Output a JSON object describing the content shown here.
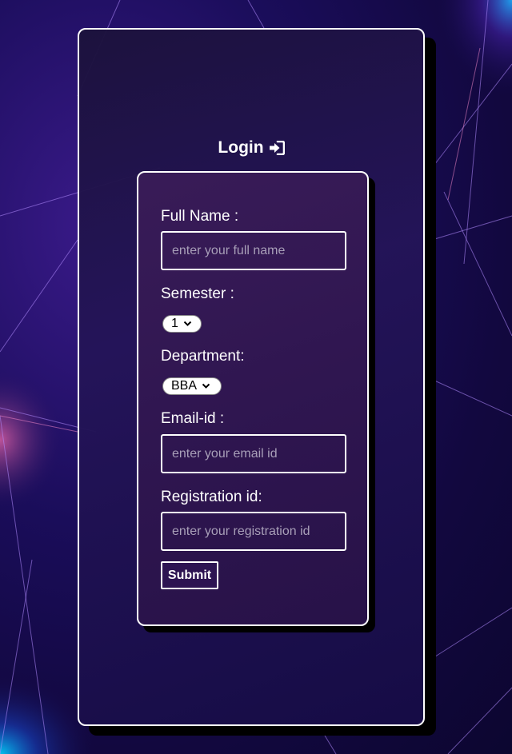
{
  "form": {
    "title": "Login",
    "fields": {
      "full_name": {
        "label": "Full Name :",
        "placeholder": "enter your full name",
        "value": ""
      },
      "semester": {
        "label": "Semester :",
        "selected": "1"
      },
      "department": {
        "label": "Department:",
        "selected": "BBA"
      },
      "email": {
        "label": "Email-id :",
        "placeholder": "enter your email id",
        "value": ""
      },
      "registration": {
        "label": "Registration id:",
        "placeholder": "enter your registration id",
        "value": ""
      }
    },
    "submit_label": "Submit"
  },
  "icons": {
    "login": "sign-in-icon",
    "dropdown": "chevron-down-icon"
  },
  "colors": {
    "text": "#ffffff",
    "border": "#ffffff",
    "card_shadow": "#000000",
    "background": "#1a0d5a"
  }
}
